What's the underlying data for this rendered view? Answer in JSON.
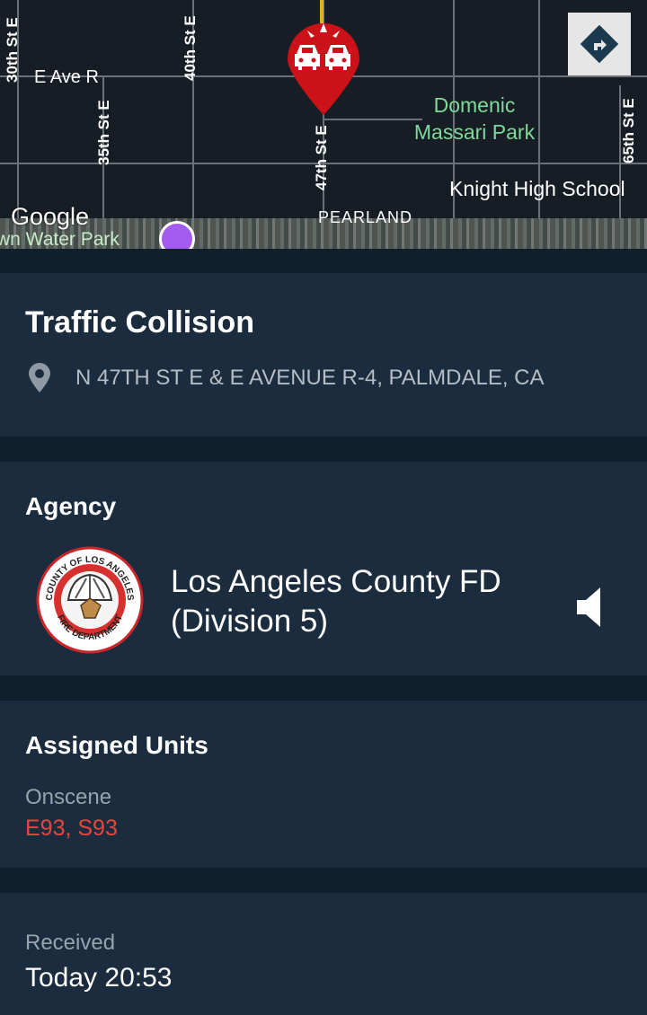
{
  "map": {
    "streets": {
      "st30": "30th St E",
      "ave_r": "E Ave R",
      "st40": "40th St E",
      "st35": "35th St E",
      "st47": "47th St E",
      "st65": "65th St E"
    },
    "park": "Domenic Massari Park",
    "school": "Knight High School",
    "google": "Google",
    "water_park": "wn Water Park",
    "region": "PEARLAND",
    "marker_icon": "car-collision-icon",
    "marker_color": "#cc1219",
    "directions_icon": "directions-icon"
  },
  "incident": {
    "title": "Traffic Collision",
    "location_icon": "location-pin-icon",
    "address": "N 47TH ST E & E AVENUE R-4, PALMDALE, CA"
  },
  "agency": {
    "heading": "Agency",
    "name": "Los Angeles County FD (Division 5)",
    "logo_text_top": "COUNTY OF LOS ANGELES",
    "logo_text_bottom": "FIRE DEPARTMENT",
    "audio_icon": "speaker-icon"
  },
  "units": {
    "heading": "Assigned Units",
    "status_label": "Onscene",
    "list": "E93, S93",
    "status_color": "#e8453c"
  },
  "received": {
    "label": "Received",
    "value": "Today 20:53"
  }
}
